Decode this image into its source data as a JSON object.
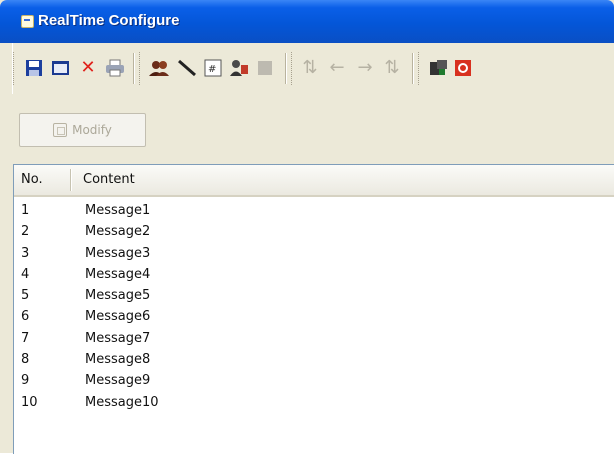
{
  "window": {
    "title": "RealTime Configure"
  },
  "toolbar": {
    "icons": [
      "save-icon",
      "window-icon",
      "delete-icon",
      "print-icon",
      "users-icon",
      "pen-icon",
      "form-icon",
      "config-icon",
      "disabled-icon",
      "align-icon",
      "left-icon",
      "right-icon",
      "sort-icon",
      "export-icon",
      "stop-icon"
    ]
  },
  "modify_button": {
    "label": "Modify"
  },
  "list": {
    "columns": [
      "No.",
      "Content"
    ],
    "rows": [
      {
        "no": "1",
        "content": "Message1"
      },
      {
        "no": "2",
        "content": "Message2"
      },
      {
        "no": "3",
        "content": "Message3"
      },
      {
        "no": "4",
        "content": "Message4"
      },
      {
        "no": "5",
        "content": "Message5"
      },
      {
        "no": "6",
        "content": "Message6"
      },
      {
        "no": "7",
        "content": "Message7"
      },
      {
        "no": "8",
        "content": "Message8"
      },
      {
        "no": "9",
        "content": "Message9"
      },
      {
        "no": "10",
        "content": "Message10"
      }
    ]
  }
}
